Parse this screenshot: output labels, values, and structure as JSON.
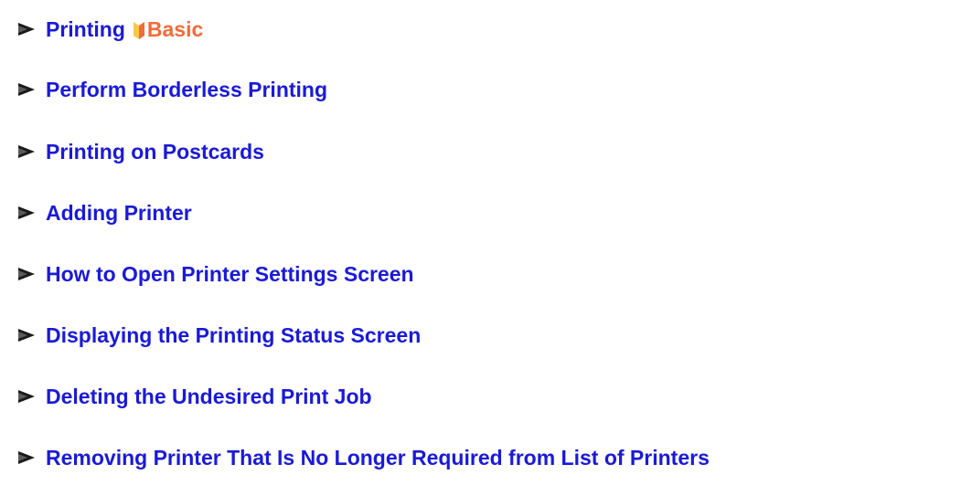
{
  "links": [
    {
      "label": "Printing",
      "badge": "Basic"
    },
    {
      "label": "Perform Borderless Printing"
    },
    {
      "label": "Printing on Postcards"
    },
    {
      "label": "Adding Printer"
    },
    {
      "label": "How to Open Printer Settings Screen"
    },
    {
      "label": "Displaying the Printing Status Screen"
    },
    {
      "label": "Deleting the Undesired Print Job"
    },
    {
      "label": "Removing Printer That Is No Longer Required from List of Printers"
    }
  ],
  "colors": {
    "link": "#1a1ad8",
    "badge_text": "#f26b3a",
    "badge_icon_left": "#f7c948",
    "badge_icon_right": "#f26b3a",
    "arrow": "#1a1a1a"
  },
  "icons": {
    "bullet": "arrow-right-icon",
    "badge": "beginner-mark-icon"
  }
}
